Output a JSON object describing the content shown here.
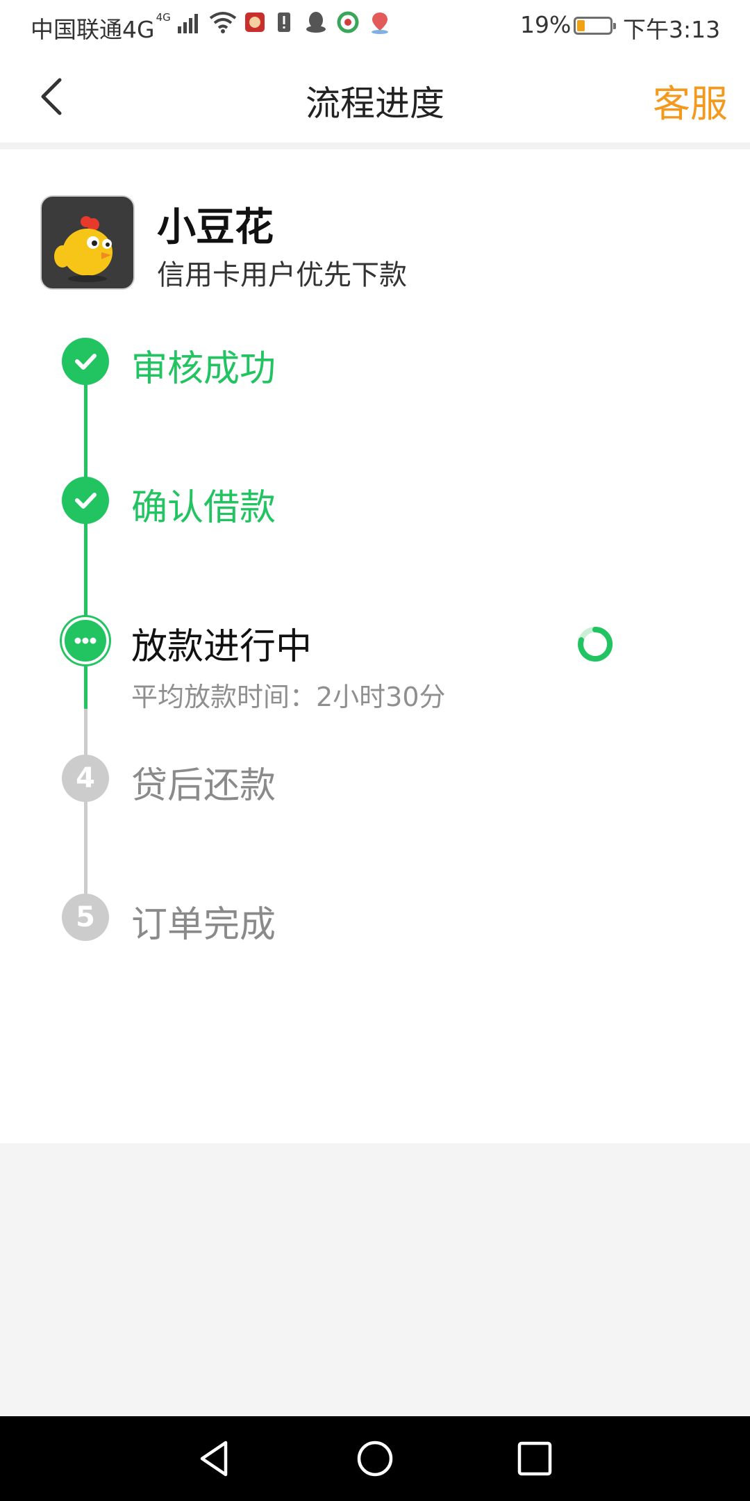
{
  "status_bar": {
    "carrier": "中国联通4G",
    "network_badge": "4G",
    "battery_percent": "19%",
    "battery_level": 0.19,
    "time": "下午3:13"
  },
  "header": {
    "title": "流程进度",
    "service_label": "客服"
  },
  "app": {
    "name": "小豆花",
    "description": "信用卡用户优先下款"
  },
  "steps": [
    {
      "label": "审核成功",
      "status": "done"
    },
    {
      "label": "确认借款",
      "status": "done"
    },
    {
      "label": "放款进行中",
      "status": "current",
      "subtitle": "平均放款时间：2小时30分"
    },
    {
      "label": "贷后还款",
      "status": "pending",
      "number": "4"
    },
    {
      "label": "订单完成",
      "status": "pending",
      "number": "5"
    }
  ],
  "colors": {
    "accent_green": "#22c462",
    "accent_orange": "#f39a1e",
    "pending_gray": "#cccccc"
  },
  "icons": {
    "back": "chevron-left-icon",
    "done": "check-icon",
    "current": "ellipsis-icon",
    "loading": "spinner-icon",
    "sys_back": "triangle-back-icon",
    "sys_home": "circle-home-icon",
    "sys_recent": "square-recents-icon"
  }
}
